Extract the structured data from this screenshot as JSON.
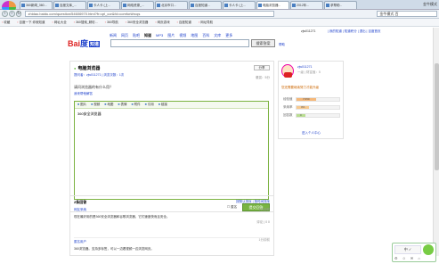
{
  "browser": {
    "tabs": [
      {
        "label": "360新闻_360..."
      },
      {
        "label": "百度文库_..."
      },
      {
        "label": "卡人卡 (上..."
      },
      {
        "label": "网络资源_..."
      },
      {
        "label": "北京市口..."
      },
      {
        "label": "百度知道..."
      },
      {
        "label": "卡人卡 (上..."
      },
      {
        "label": "电脑浏览器..."
      },
      {
        "label": "2012年..."
      },
      {
        "label": "求帮助..."
      }
    ],
    "search_right_label": "金牛模式",
    "url": "zhidao.baidu.com/question/54606970.html?fr=qrl_cor&fd=comfort#rcqs",
    "search_box_value": "金牛模式 百",
    "bookmarks": [
      "收藏",
      "百度一下,你就知道",
      "网址大全",
      "360搜索_精彩...",
      "360导航",
      "360安全浏览器",
      "网页游戏",
      "百度知道",
      "网址导航"
    ]
  },
  "page": {
    "user": "zjw011271",
    "top_links": "| 我的知道 | 知道积分 | 退出 | 百度首页",
    "logo": {
      "text": "Bai",
      "paw": "度",
      "zhidao": "知道"
    },
    "nav_tabs": [
      "新闻",
      "网页",
      "贴吧",
      "知道",
      "MP3",
      "图片",
      "视频",
      "地图",
      "百科",
      "文库",
      "更多"
    ],
    "current_tab": "知道",
    "search_button": "搜索答案",
    "help_link": "帮助"
  },
  "question": {
    "title": "电脑浏览器",
    "share_button": "分享",
    "meta": "提问者：zjw011271 | 浏览次数：1次",
    "meta_right": "悬赏：5分",
    "body": "请问浏览器的有什么用？",
    "add_link": "我来帮他解答",
    "toolbar": [
      "图片",
      "视频",
      "地图",
      "表情",
      "附件",
      "引用",
      "链接"
    ],
    "answer_text": "360安全浏览器",
    "anonymous_label": "匿名",
    "submit_button": "提交回答"
  },
  "answers": {
    "header": "2条回答",
    "sort": "按默认排序 | 按时间排序",
    "items": [
      {
        "name": "网友采纳",
        "time": "1分钟前",
        "text": "现在最好用的是360安全浏览器和谷歌浏览器，它们速度快而且安全。",
        "vote": "评论 | 0 0"
      },
      {
        "name": "匿名用户",
        "time": "1分钟前",
        "text": "360浏览器。支持多标签，可以一边看视频一边浏览网页。",
        "vote": ""
      }
    ]
  },
  "profile": {
    "name": "zjw011271",
    "level": "一级 | 财富值：5",
    "note": "您还需要继续努力才能升级",
    "bars": [
      {
        "label": "经验值",
        "value": 0.45,
        "text": "7/150"
      },
      {
        "label": "采纳率",
        "value": 0.3,
        "text": "0%"
      },
      {
        "label": "回答数",
        "value": 0.2,
        "text": "0"
      }
    ],
    "link": "进入个人中心"
  },
  "widget": {
    "label": "中 ✓",
    "icons": "⚙ ☺ ✉ ⌂"
  },
  "colors": {
    "accent": "#2244cc",
    "submit": "#78b442",
    "logo_red": "#dd2222"
  }
}
